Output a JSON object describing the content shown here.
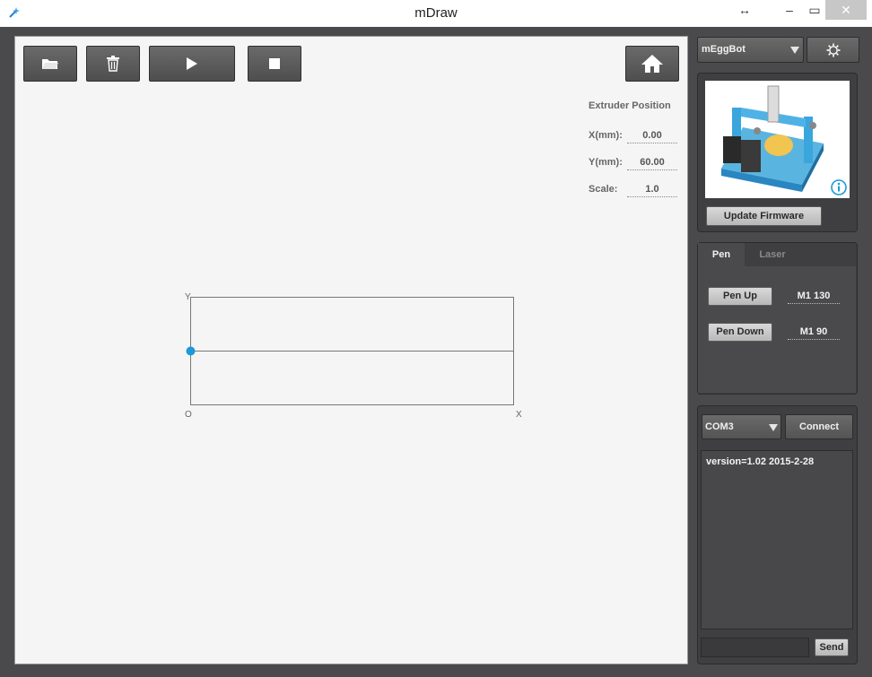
{
  "window": {
    "title": "mDraw"
  },
  "toolbar": {
    "open_icon": "folder-open-icon",
    "delete_icon": "trash-icon",
    "play_icon": "play-icon",
    "stop_icon": "stop-icon",
    "home_icon": "home-icon"
  },
  "extruder": {
    "title": "Extruder Position",
    "x_label": "X(mm):",
    "x_value": "0.00",
    "y_label": "Y(mm):",
    "y_value": "60.00",
    "scale_label": "Scale:",
    "scale_value": "1.0"
  },
  "canvas": {
    "y_axis_label": "Y",
    "origin_label": "O",
    "x_axis_label": "X",
    "accent_color": "#1a9ad9"
  },
  "machine": {
    "selected": "mEggBot",
    "settings_icon": "gear-icon",
    "info_icon": "info-icon",
    "update_firmware_label": "Update Firmware"
  },
  "tabs": [
    {
      "label": "Pen",
      "active": true
    },
    {
      "label": "Laser",
      "active": false
    }
  ],
  "pen": {
    "up_label": "Pen Up",
    "up_cmd": "M1 130",
    "down_label": "Pen Down",
    "down_cmd": "M1 90"
  },
  "serial": {
    "port": "COM3",
    "connect_label": "Connect",
    "console_text": "version=1.02 2015-2-28",
    "send_label": "Send"
  }
}
